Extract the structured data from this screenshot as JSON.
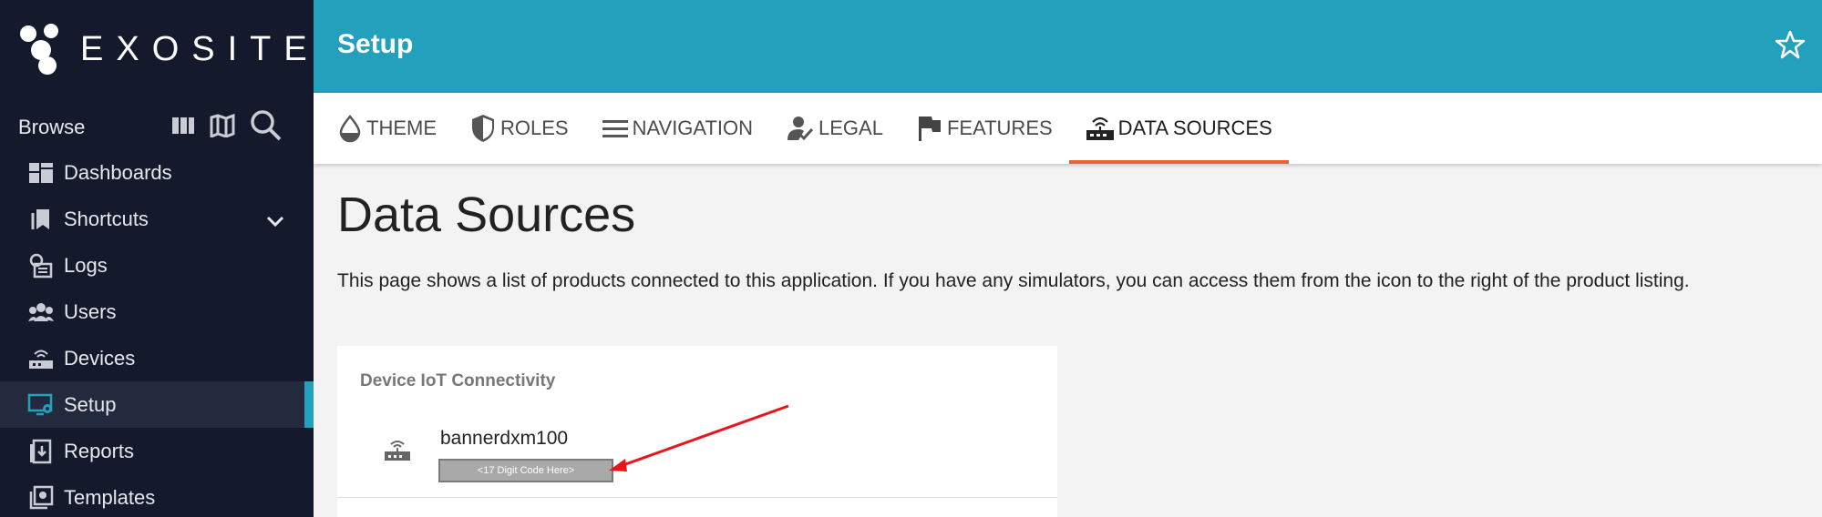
{
  "brand": {
    "name": "EXOSITE"
  },
  "sidebar": {
    "browse_label": "Browse",
    "browse_icons": [
      "columns-icon",
      "map-icon",
      "search-icon"
    ],
    "items": [
      {
        "label": "Dashboards",
        "icon": "dashboard-icon"
      },
      {
        "label": "Shortcuts",
        "icon": "bookmark-icon",
        "expandable": true
      },
      {
        "label": "Logs",
        "icon": "logs-icon"
      },
      {
        "label": "Users",
        "icon": "users-icon"
      },
      {
        "label": "Devices",
        "icon": "router-icon"
      },
      {
        "label": "Setup",
        "icon": "monitor-gear-icon",
        "active": true
      },
      {
        "label": "Reports",
        "icon": "reports-icon"
      },
      {
        "label": "Templates",
        "icon": "templates-icon"
      }
    ]
  },
  "header": {
    "title": "Setup"
  },
  "tabs": [
    {
      "label": "THEME",
      "icon": "drop-icon"
    },
    {
      "label": "ROLES",
      "icon": "shield-icon"
    },
    {
      "label": "NAVIGATION",
      "icon": "menu-icon"
    },
    {
      "label": "LEGAL",
      "icon": "user-check-icon"
    },
    {
      "label": "FEATURES",
      "icon": "flag-icon"
    },
    {
      "label": "DATA SOURCES",
      "icon": "router-icon",
      "active": true
    }
  ],
  "main": {
    "title": "Data Sources",
    "description": "This page shows a list of products connected to this application. If you have any simulators, you can access them from the icon to the right of the product listing.",
    "card": {
      "title": "Device IoT Connectivity",
      "product": {
        "name": "bannerdxm100",
        "code_placeholder": "<17 Digit Code Here>"
      }
    }
  },
  "colors": {
    "sidebar_bg": "#141a2c",
    "accent": "#22a0bc",
    "tab_active": "#e8632d",
    "annotation_arrow": "#e8161b"
  }
}
